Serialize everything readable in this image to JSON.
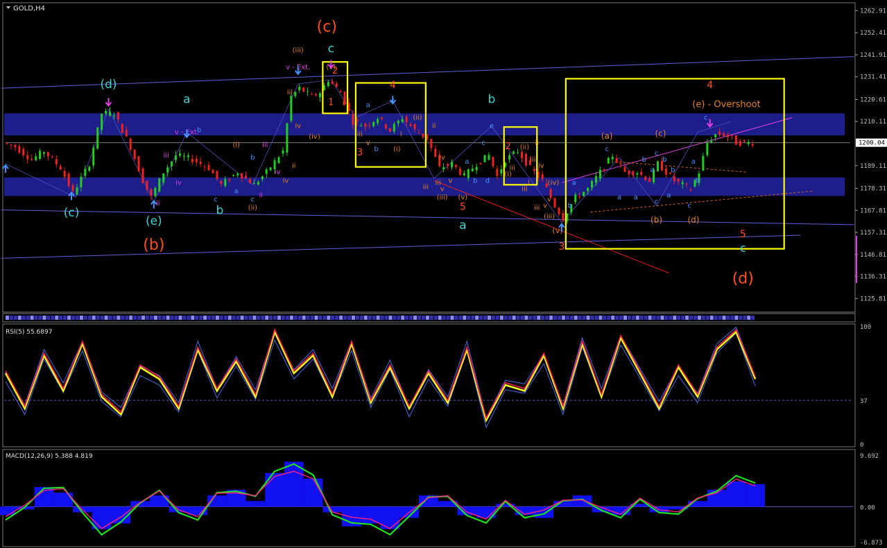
{
  "window": {
    "symbol_title": "GOLD,H4",
    "rsi_title": "RSI(5) 55.6897",
    "macd_title": "MACD(12,26,9) 5.388 4.819"
  },
  "colors": {
    "background": "#000000",
    "bull_candle": "#22cc22",
    "bear_candle": "#ee2222",
    "zone": "#1e1e8a",
    "channel": "#6060d8",
    "box": "#ffff00",
    "wave_red": "#ff5020",
    "wave_cyan": "#40d0d0",
    "wave_orange": "#e08020",
    "wave_blue": "#4a90ff",
    "wave_magenta": "#e040e0",
    "rsi_yellow": "#ffff20",
    "rsi_red": "#ff2050",
    "macd_hist": "#1010f0",
    "macd_green": "#20e020",
    "macd_red": "#ff2080",
    "axis_text": "#c0c0c0"
  },
  "price_axis": {
    "min": 1120.0,
    "max": 1266.0,
    "ticks": [
      "1262.91",
      "1252.41",
      "1241.91",
      "1231.41",
      "1220.61",
      "1210.11",
      "1189.11",
      "1178.31",
      "1167.81",
      "1157.31",
      "1146.81",
      "1136.31",
      "1125.81"
    ],
    "current_price": "1200.04"
  },
  "rsi_axis": {
    "min": 0,
    "max": 100,
    "ticks": [
      "100",
      "37",
      "0"
    ],
    "level": 37
  },
  "macd_axis": {
    "min": -6.873,
    "max": 9.692,
    "ticks": [
      "9.692",
      "0.00",
      "-6.873"
    ]
  },
  "wave_labels": [
    {
      "text": "(c)",
      "color": "wave_red",
      "size": 22,
      "bar": 78,
      "price": 1253
    },
    {
      "text": "c",
      "color": "wave_cyan",
      "size": 17,
      "bar": 79,
      "price": 1243
    },
    {
      "text": "(d)",
      "color": "wave_cyan",
      "size": 17,
      "bar": 25,
      "price": 1226
    },
    {
      "text": "a",
      "color": "wave_cyan",
      "size": 17,
      "bar": 44,
      "price": 1219
    },
    {
      "text": "b",
      "color": "wave_cyan",
      "size": 17,
      "bar": 118,
      "price": 1219
    },
    {
      "text": "(c)",
      "color": "wave_cyan",
      "size": 17,
      "bar": 16,
      "price": 1165
    },
    {
      "text": "(e)",
      "color": "wave_cyan",
      "size": 17,
      "bar": 36,
      "price": 1161
    },
    {
      "text": "b",
      "color": "wave_cyan",
      "size": 17,
      "bar": 52,
      "price": 1166
    },
    {
      "text": "(b)",
      "color": "wave_red",
      "size": 22,
      "bar": 36,
      "price": 1149
    },
    {
      "text": "a",
      "color": "wave_cyan",
      "size": 17,
      "bar": 111,
      "price": 1159
    },
    {
      "text": "5",
      "color": "wave_red",
      "size": 14,
      "bar": 111,
      "price": 1168
    },
    {
      "text": "3",
      "color": "wave_red",
      "size": 14,
      "bar": 135,
      "price": 1149
    },
    {
      "text": "(v)",
      "color": "wave_orange",
      "size": 11,
      "bar": 134,
      "price": 1157
    },
    {
      "text": "4",
      "color": "wave_red",
      "size": 14,
      "bar": 94,
      "price": 1226
    },
    {
      "text": "3",
      "color": "wave_red",
      "size": 14,
      "bar": 86,
      "price": 1194
    },
    {
      "text": "1",
      "color": "wave_red",
      "size": 13,
      "bar": 79,
      "price": 1218
    },
    {
      "text": "2",
      "color": "wave_red",
      "size": 13,
      "bar": 80,
      "price": 1233
    },
    {
      "text": "2",
      "color": "wave_red",
      "size": 13,
      "bar": 122,
      "price": 1197
    },
    {
      "text": "4",
      "color": "wave_red",
      "size": 14,
      "bar": 171,
      "price": 1226
    },
    {
      "text": "(e) - Overshoot",
      "color": "wave_orange",
      "size": 13,
      "bar": 175,
      "price": 1217
    },
    {
      "text": "(a)",
      "color": "wave_orange",
      "size": 12,
      "bar": 146,
      "price": 1202
    },
    {
      "text": "(c)",
      "color": "wave_orange",
      "size": 12,
      "bar": 159,
      "price": 1203
    },
    {
      "text": "(b)",
      "color": "wave_orange",
      "size": 12,
      "bar": 158,
      "price": 1162
    },
    {
      "text": "(d)",
      "color": "wave_orange",
      "size": 12,
      "bar": 167,
      "price": 1162
    },
    {
      "text": "5",
      "color": "wave_red",
      "size": 14,
      "bar": 179,
      "price": 1155
    },
    {
      "text": "c",
      "color": "wave_cyan",
      "size": 16,
      "bar": 179,
      "price": 1148
    },
    {
      "text": "(d)",
      "color": "wave_red",
      "size": 22,
      "bar": 179,
      "price": 1133
    },
    {
      "text": "(iii)",
      "color": "wave_orange",
      "size": 10,
      "bar": 71,
      "price": 1243
    },
    {
      "text": "v - Ext.",
      "color": "wave_magenta",
      "size": 10,
      "bar": 71,
      "price": 1235
    },
    {
      "text": "v - Ext.",
      "color": "wave_magenta",
      "size": 10,
      "bar": 44,
      "price": 1204
    },
    {
      "text": "(v)",
      "color": "wave_orange",
      "size": 10,
      "bar": 79,
      "price": 1235
    },
    {
      "text": "(iv)",
      "color": "wave_orange",
      "size": 10,
      "bar": 75,
      "price": 1202
    },
    {
      "text": "(i)",
      "color": "wave_orange",
      "size": 10,
      "bar": 56,
      "price": 1198
    },
    {
      "text": "(ii)",
      "color": "wave_orange",
      "size": 10,
      "bar": 60,
      "price": 1168
    },
    {
      "text": "(iii)",
      "color": "wave_orange",
      "size": 10,
      "bar": 106,
      "price": 1173
    },
    {
      "text": "(v)",
      "color": "wave_orange",
      "size": 10,
      "bar": 111,
      "price": 1173
    },
    {
      "text": "(i)",
      "color": "wave_orange",
      "size": 10,
      "bar": 95,
      "price": 1196
    },
    {
      "text": "(ii)",
      "color": "wave_orange",
      "size": 10,
      "bar": 100,
      "price": 1211
    },
    {
      "text": "(i)",
      "color": "wave_orange",
      "size": 10,
      "bar": 122,
      "price": 1184
    },
    {
      "text": "(ii)",
      "color": "wave_orange",
      "size": 10,
      "bar": 126,
      "price": 1197
    },
    {
      "text": "(iii)",
      "color": "wave_orange",
      "size": 10,
      "bar": 132,
      "price": 1164
    },
    {
      "text": "(iv)",
      "color": "wave_orange",
      "size": 10,
      "bar": 133,
      "price": 1180
    },
    {
      "text": "iii",
      "color": "wave_magenta",
      "size": 10,
      "bar": 39,
      "price": 1193
    },
    {
      "text": "iii",
      "color": "wave_magenta",
      "size": 10,
      "bar": 63,
      "price": 1198
    },
    {
      "text": "iv",
      "color": "wave_magenta",
      "size": 10,
      "bar": 42,
      "price": 1180
    },
    {
      "text": "iv",
      "color": "wave_magenta",
      "size": 10,
      "bar": 66,
      "price": 1185
    },
    {
      "text": "ii",
      "color": "wave_magenta",
      "size": 10,
      "bar": 37,
      "price": 1170
    },
    {
      "text": "ii",
      "color": "wave_magenta",
      "size": 10,
      "bar": 62,
      "price": 1174
    },
    {
      "text": "c",
      "color": "wave_blue",
      "size": 10,
      "bar": 51,
      "price": 1172
    },
    {
      "text": "a",
      "color": "wave_blue",
      "size": 10,
      "bar": 56,
      "price": 1176
    },
    {
      "text": "c",
      "color": "wave_blue",
      "size": 10,
      "bar": 60,
      "price": 1172
    },
    {
      "text": "b",
      "color": "wave_blue",
      "size": 10,
      "bar": 60,
      "price": 1192
    },
    {
      "text": "b",
      "color": "wave_blue",
      "size": 10,
      "bar": 47,
      "price": 1205
    },
    {
      "text": "a",
      "color": "wave_blue",
      "size": 10,
      "bar": 88,
      "price": 1217
    },
    {
      "text": "b",
      "color": "wave_blue",
      "size": 10,
      "bar": 90,
      "price": 1196
    },
    {
      "text": "c",
      "color": "wave_blue",
      "size": 10,
      "bar": 94,
      "price": 1219
    },
    {
      "text": "a",
      "color": "wave_blue",
      "size": 10,
      "bar": 112,
      "price": 1190
    },
    {
      "text": "b",
      "color": "wave_blue",
      "size": 10,
      "bar": 114,
      "price": 1181
    },
    {
      "text": "c",
      "color": "wave_blue",
      "size": 10,
      "bar": 116,
      "price": 1199
    },
    {
      "text": "d",
      "color": "wave_blue",
      "size": 10,
      "bar": 117,
      "price": 1181
    },
    {
      "text": "e",
      "color": "wave_blue",
      "size": 10,
      "bar": 118,
      "price": 1207
    },
    {
      "text": "b",
      "color": "wave_blue",
      "size": 10,
      "bar": 137,
      "price": 1169
    },
    {
      "text": "a",
      "color": "wave_blue",
      "size": 10,
      "bar": 138,
      "price": 1180
    },
    {
      "text": "c",
      "color": "wave_blue",
      "size": 10,
      "bar": 146,
      "price": 1196
    },
    {
      "text": "a",
      "color": "wave_blue",
      "size": 10,
      "bar": 149,
      "price": 1173
    },
    {
      "text": "a",
      "color": "wave_blue",
      "size": 10,
      "bar": 153,
      "price": 1173
    },
    {
      "text": "b",
      "color": "wave_blue",
      "size": 10,
      "bar": 155,
      "price": 1191
    },
    {
      "text": "a",
      "color": "wave_blue",
      "size": 10,
      "bar": 157,
      "price": 1186
    },
    {
      "text": "c",
      "color": "wave_blue",
      "size": 10,
      "bar": 158,
      "price": 1194
    },
    {
      "text": "b",
      "color": "wave_blue",
      "size": 10,
      "bar": 160,
      "price": 1191
    },
    {
      "text": "c",
      "color": "wave_blue",
      "size": 10,
      "bar": 158,
      "price": 1171
    },
    {
      "text": "a",
      "color": "wave_blue",
      "size": 10,
      "bar": 161,
      "price": 1174
    },
    {
      "text": "b",
      "color": "wave_blue",
      "size": 10,
      "bar": 162,
      "price": 1186
    },
    {
      "text": "c",
      "color": "wave_blue",
      "size": 10,
      "bar": 166,
      "price": 1169
    },
    {
      "text": "a",
      "color": "wave_blue",
      "size": 10,
      "bar": 167,
      "price": 1190
    },
    {
      "text": "b",
      "color": "wave_blue",
      "size": 10,
      "bar": 168,
      "price": 1181
    },
    {
      "text": "c",
      "color": "wave_blue",
      "size": 10,
      "bar": 170,
      "price": 1211
    },
    {
      "text": "i",
      "color": "wave_orange",
      "size": 10,
      "bar": 96,
      "price": 1203
    },
    {
      "text": "iv",
      "color": "wave_orange",
      "size": 10,
      "bar": 106,
      "price": 1192
    },
    {
      "text": "iii",
      "color": "wave_orange",
      "size": 10,
      "bar": 102,
      "price": 1178
    },
    {
      "text": "v",
      "color": "wave_orange",
      "size": 10,
      "bar": 106,
      "price": 1177
    },
    {
      "text": "iii",
      "color": "wave_orange",
      "size": 10,
      "bar": 123,
      "price": 1187
    },
    {
      "text": "ii",
      "color": "wave_orange",
      "size": 10,
      "bar": 129,
      "price": 1199
    },
    {
      "text": "iv",
      "color": "wave_orange",
      "size": 10,
      "bar": 130,
      "price": 1188
    },
    {
      "text": "v",
      "color": "wave_orange",
      "size": 10,
      "bar": 132,
      "price": 1172
    },
    {
      "text": "iii",
      "color": "wave_orange",
      "size": 10,
      "bar": 129,
      "price": 1168
    },
    {
      "text": "iv",
      "color": "wave_orange",
      "size": 10,
      "bar": 71,
      "price": 1207
    },
    {
      "text": "iii",
      "color": "wave_orange",
      "size": 10,
      "bar": 69,
      "price": 1223
    },
    {
      "text": "ii",
      "color": "wave_orange",
      "size": 10,
      "bar": 70,
      "price": 1188
    },
    {
      "text": "iv",
      "color": "wave_orange",
      "size": 10,
      "bar": 68,
      "price": 1181
    },
    {
      "text": "i",
      "color": "wave_orange",
      "size": 10,
      "bar": 82,
      "price": 1218
    },
    {
      "text": "ii",
      "color": "wave_orange",
      "size": 10,
      "bar": 104,
      "price": 1207
    },
    {
      "text": "iii",
      "color": "wave_orange",
      "size": 10,
      "bar": 86,
      "price": 1203
    },
    {
      "text": "v",
      "color": "wave_orange",
      "size": 10,
      "bar": 88,
      "price": 1199
    },
    {
      "text": "v",
      "color": "wave_orange",
      "size": 10,
      "bar": 108,
      "price": 1181
    },
    {
      "text": "iii",
      "color": "wave_orange",
      "size": 10,
      "bar": 105,
      "price": 1180
    },
    {
      "text": "i",
      "color": "wave_orange",
      "size": 10,
      "bar": 127,
      "price": 1180
    },
    {
      "text": "v",
      "color": "wave_orange",
      "size": 10,
      "bar": 131,
      "price": 1169
    },
    {
      "text": "iii",
      "color": "wave_orange",
      "size": 10,
      "bar": 126,
      "price": 1177
    },
    {
      "text": "iii",
      "color": "wave_orange",
      "size": 10,
      "bar": 128,
      "price": 1191
    }
  ],
  "arrows": [
    {
      "dir": "down",
      "color": "wave_magenta",
      "bar": 25,
      "price": 1218
    },
    {
      "dir": "up",
      "color": "wave_blue",
      "bar": 16,
      "price": 1176
    },
    {
      "dir": "up",
      "color": "wave_blue",
      "bar": 36,
      "price": 1172
    },
    {
      "dir": "down",
      "color": "wave_blue",
      "bar": 44,
      "price": 1203
    },
    {
      "dir": "down",
      "color": "wave_blue",
      "bar": 71,
      "price": 1233
    },
    {
      "dir": "down",
      "color": "wave_magenta",
      "bar": 79,
      "price": 1236
    },
    {
      "dir": "down",
      "color": "wave_blue",
      "bar": 94,
      "price": 1219
    },
    {
      "dir": "up",
      "color": "wave_blue",
      "bar": 135,
      "price": 1161
    },
    {
      "dir": "down",
      "color": "wave_magenta",
      "bar": 171,
      "price": 1208
    },
    {
      "dir": "up",
      "color": "wave_blue",
      "bar": 0,
      "price": 1189
    }
  ],
  "chart_data": [
    {
      "type": "candlestick",
      "title": "GOLD,H4",
      "bars": 182,
      "y_range": [
        1120.0,
        1266.0
      ],
      "zones": [
        {
          "from": 1203.5,
          "to": 1214.0
        },
        {
          "from": 1174.7,
          "to": 1183.5
        }
      ],
      "boxes": [
        {
          "from_bar": 77,
          "to_bar": 83,
          "top": 1238.5,
          "bottom": 1214.0
        },
        {
          "from_bar": 85,
          "to_bar": 102,
          "top": 1228.5,
          "bottom": 1188.5
        },
        {
          "from_bar": 121,
          "to_bar": 129,
          "top": 1207.5,
          "bottom": 1180.0
        },
        {
          "from_bar": 136,
          "to_bar": 189,
          "top": 1230.5,
          "bottom": 1149.5
        }
      ],
      "anchors": [
        [
          0,
          1200
        ],
        [
          3,
          1198
        ],
        [
          7,
          1192
        ],
        [
          10,
          1196
        ],
        [
          14,
          1188
        ],
        [
          17,
          1176
        ],
        [
          21,
          1190
        ],
        [
          24,
          1214
        ],
        [
          27,
          1214
        ],
        [
          31,
          1198
        ],
        [
          34,
          1182
        ],
        [
          36,
          1174
        ],
        [
          39,
          1186
        ],
        [
          42,
          1194
        ],
        [
          46,
          1192
        ],
        [
          50,
          1188
        ],
        [
          53,
          1180
        ],
        [
          57,
          1186
        ],
        [
          61,
          1180
        ],
        [
          64,
          1186
        ],
        [
          68,
          1196
        ],
        [
          70,
          1222
        ],
        [
          72,
          1226
        ],
        [
          75,
          1222
        ],
        [
          77,
          1224
        ],
        [
          79,
          1230
        ],
        [
          82,
          1224
        ],
        [
          85,
          1210
        ],
        [
          88,
          1208
        ],
        [
          91,
          1212
        ],
        [
          94,
          1206
        ],
        [
          97,
          1212
        ],
        [
          100,
          1206
        ],
        [
          103,
          1202
        ],
        [
          106,
          1188
        ],
        [
          109,
          1190
        ],
        [
          112,
          1184
        ],
        [
          115,
          1190
        ],
        [
          118,
          1194
        ],
        [
          120,
          1184
        ],
        [
          122,
          1192
        ],
        [
          125,
          1196
        ],
        [
          128,
          1188
        ],
        [
          131,
          1182
        ],
        [
          134,
          1170
        ],
        [
          136,
          1164
        ],
        [
          139,
          1174
        ],
        [
          142,
          1178
        ],
        [
          145,
          1186
        ],
        [
          148,
          1194
        ],
        [
          151,
          1186
        ],
        [
          154,
          1186
        ],
        [
          157,
          1182
        ],
        [
          159,
          1190
        ],
        [
          161,
          1186
        ],
        [
          163,
          1182
        ],
        [
          165,
          1180
        ],
        [
          167,
          1178
        ],
        [
          169,
          1186
        ],
        [
          171,
          1200
        ],
        [
          173,
          1204
        ],
        [
          175,
          1204
        ],
        [
          177,
          1202
        ],
        [
          178,
          1200
        ]
      ]
    },
    {
      "type": "line",
      "title": "RSI(5) 55.6897",
      "y_range": [
        0,
        100
      ],
      "series": [
        {
          "values": [
            60,
            30,
            75,
            45,
            85,
            40,
            25,
            65,
            55,
            30,
            80,
            45,
            70,
            40,
            95,
            60,
            75,
            40,
            85,
            35,
            65,
            30,
            60,
            35,
            80,
            20,
            50,
            45,
            75,
            30,
            85,
            40,
            90,
            60,
            30,
            65,
            40,
            80,
            95,
            55
          ]
        }
      ]
    },
    {
      "type": "bar",
      "title": "MACD(12,26,9) 5.388 4.819",
      "y_range": [
        -6.873,
        9.692
      ],
      "series": [
        {
          "values": [
            -1.5,
            -0.5,
            3.5,
            2.5,
            -1,
            -4,
            -3,
            1,
            2,
            -1,
            -1.5,
            2,
            3,
            1,
            6,
            8,
            5,
            -1,
            -3.5,
            -3,
            -4,
            -2,
            2,
            1,
            -1.5,
            -2,
            0.5,
            -1.5,
            -2,
            1,
            2,
            -1,
            -1.5,
            0.5,
            -1,
            -0.5,
            1,
            3,
            4.5,
            4
          ]
        }
      ]
    }
  ]
}
